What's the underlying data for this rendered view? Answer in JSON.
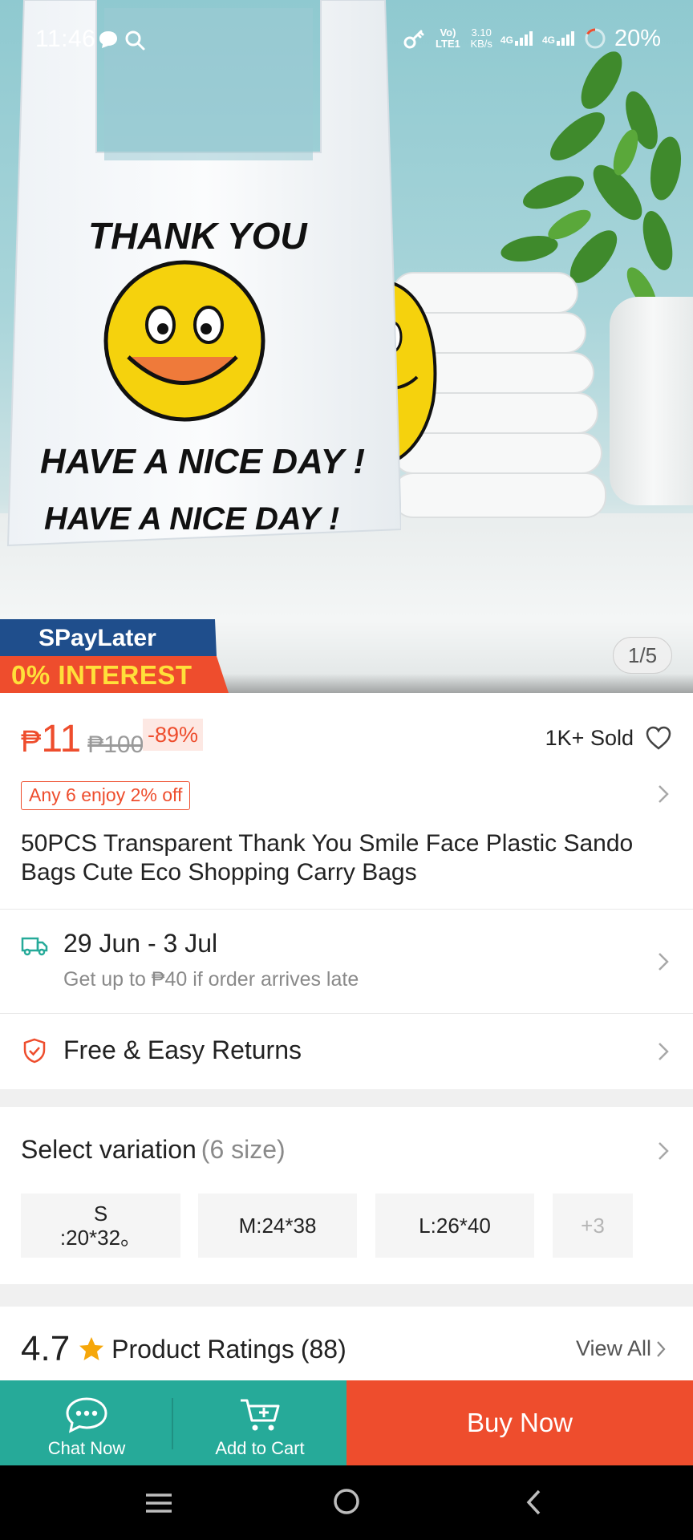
{
  "status_bar": {
    "time": "11:46",
    "network_label": "Vo) LTE1",
    "speed": "3.10",
    "speed_unit": "KB/s",
    "signal1": "4G",
    "signal2": "4G",
    "battery": "20%"
  },
  "hero": {
    "paylater_brand": "SPayLater",
    "paylater_offer": "0% INTEREST",
    "image_counter": "1/5",
    "bag_text_1": "THANK YOU",
    "bag_text_2": "HAVE A NICE DAY !",
    "bag_text_3": "HAVE A NICE DAY !"
  },
  "price": {
    "currency": "₱",
    "current": "11",
    "original": "₱100",
    "discount": "-89%"
  },
  "sold": "1K+ Sold",
  "promo_tag": "Any 6 enjoy 2% off",
  "product_title": "50PCS Transparent Thank You Smile Face Plastic Sando Bags Cute Eco Shopping Carry Bags",
  "delivery": {
    "dates": "29 Jun - 3 Jul",
    "late_note": "Get up to ₱40 if order arrives late"
  },
  "returns": "Free & Easy Returns",
  "variation": {
    "title": "Select variation",
    "count": "(6 size)",
    "options": [
      {
        "label": "S\n:20*32。"
      },
      {
        "label": "M:24*38"
      },
      {
        "label": "L:26*40"
      }
    ],
    "more": "+3"
  },
  "ratings": {
    "score": "4.7",
    "label": "Product Ratings",
    "count": "(88)",
    "view_all": "View All"
  },
  "actions": {
    "chat": "Chat Now",
    "cart": "Add to Cart",
    "buy": "Buy Now"
  },
  "colors": {
    "brand_orange": "#ee4d2d",
    "action_green": "#26aa99",
    "paylater_blue": "#1f4e8c"
  },
  "icons": [
    "chat-bubble-icon",
    "search-icon",
    "key-icon",
    "battery-icon",
    "heart-icon",
    "chevron-right-icon",
    "truck-icon",
    "shield-check-icon",
    "star-icon",
    "chat-icon",
    "cart-icon",
    "menu-icon",
    "home-circle-icon",
    "back-icon"
  ]
}
